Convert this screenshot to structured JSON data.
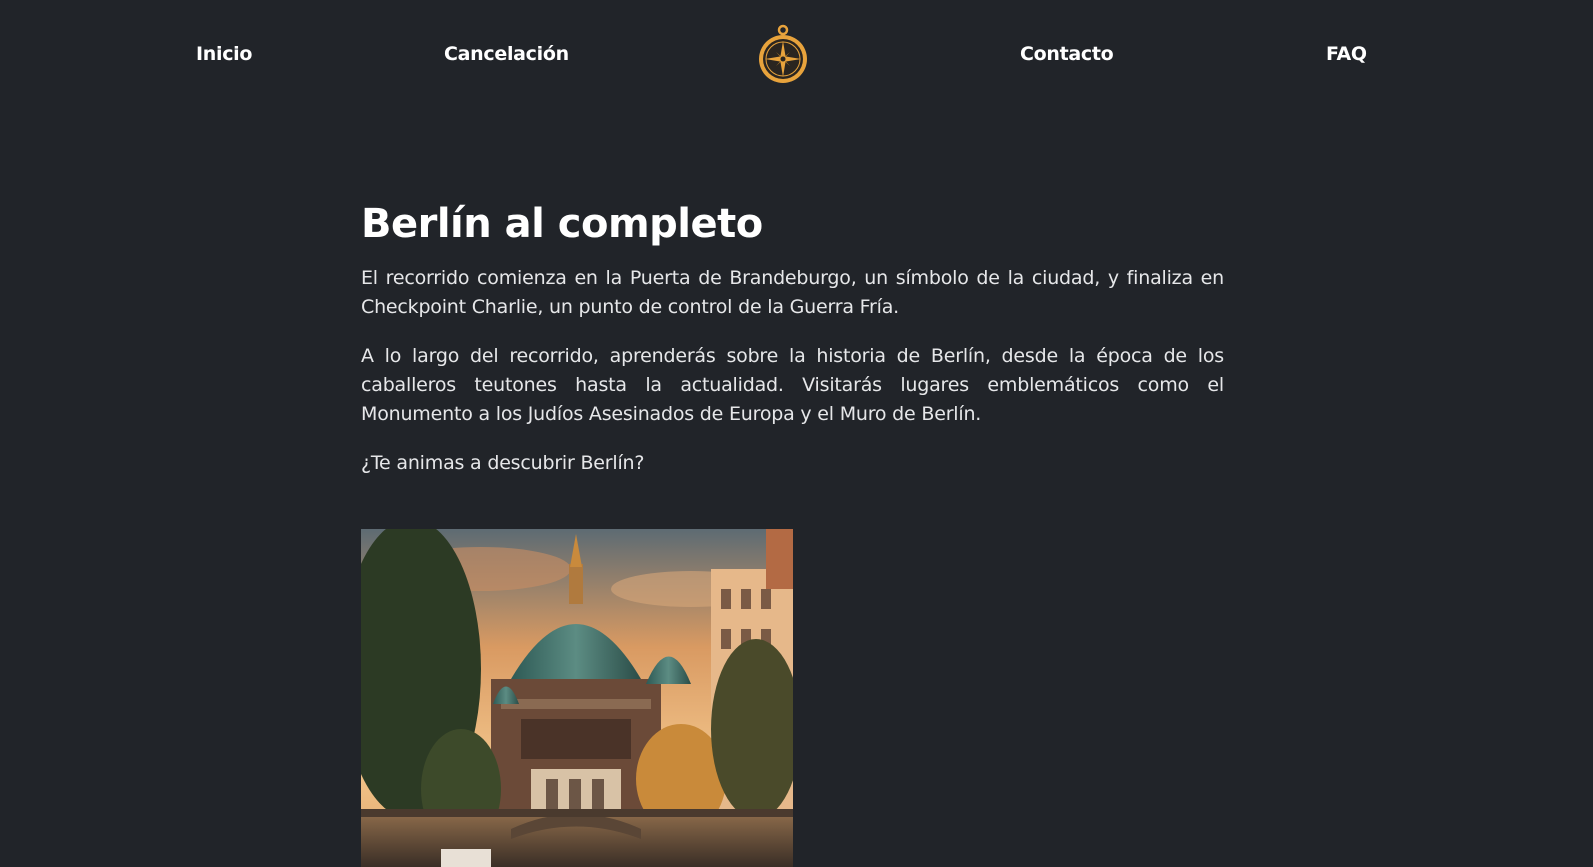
{
  "nav": {
    "items": [
      {
        "label": "Inicio"
      },
      {
        "label": "Cancelación"
      },
      {
        "label": "Contacto"
      },
      {
        "label": "FAQ"
      }
    ],
    "logo_icon": "compass-icon"
  },
  "article": {
    "title": "Berlín al completo",
    "paragraphs": [
      "El recorrido comienza en la Puerta de Brandeburgo, un símbolo de la ciudad, y finaliza en Checkpoint Charlie, un punto de control de la Guerra Fría.",
      "A lo largo del recorrido, aprenderás sobre la historia de Berlín, desde la época de los caballeros teutones hasta la actualidad. Visitarás lugares emblemáticos como el Monumento a los Judíos Asesinados de Europa y el Muro de Berlín.",
      "¿Te animas a descubrir Berlín?"
    ]
  },
  "colors": {
    "background": "#212429",
    "text": "#e6e7e9",
    "logo_gold": "#e8a33c"
  }
}
